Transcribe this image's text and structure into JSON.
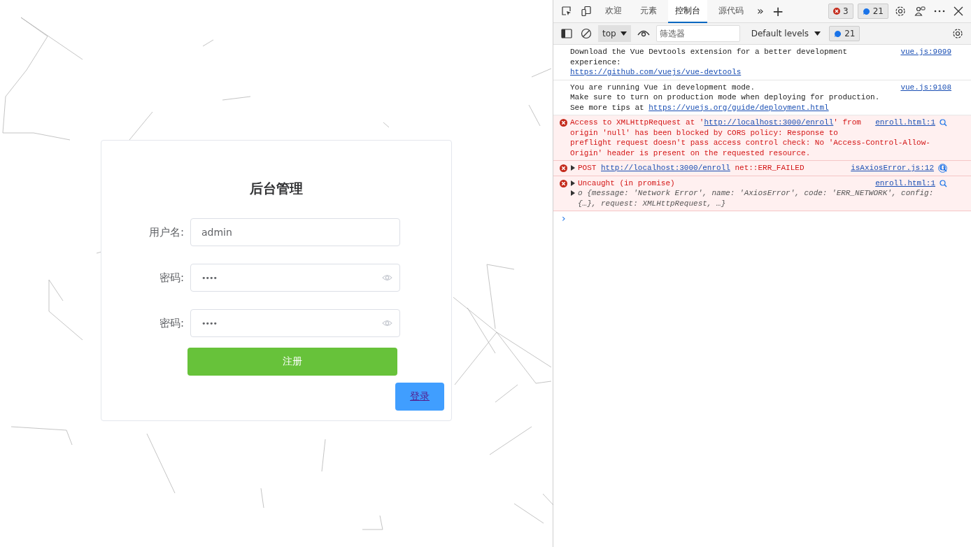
{
  "login_card": {
    "title": "后台管理",
    "fields": [
      {
        "label": "用户名:",
        "value": "admin",
        "kind": "text"
      },
      {
        "label": "密码:",
        "value": "••••",
        "kind": "password"
      },
      {
        "label": "密码:",
        "value": "••••",
        "kind": "password"
      }
    ],
    "register_button": "注册",
    "login_button": "登录"
  },
  "devtools": {
    "tabs": [
      {
        "label": "欢迎",
        "selected": false
      },
      {
        "label": "元素",
        "selected": false
      },
      {
        "label": "控制台",
        "selected": true
      },
      {
        "label": "源代码",
        "selected": false
      }
    ],
    "more_tabs": "»",
    "add_tab": "+",
    "error_count": "3",
    "message_count": "21",
    "console_toolbar": {
      "context": "top",
      "filter": {
        "placeholder": "筛选器"
      },
      "levels": "Default levels",
      "message_count": "21"
    },
    "messages": [
      {
        "kind": "info",
        "expandable": false,
        "source": "vue.js:9099",
        "lines": [
          [
            {
              "text": "Download the Vue Devtools extension for a better development",
              "link": false
            }
          ],
          [
            {
              "text": "experience:",
              "link": false
            }
          ],
          [
            {
              "text": "https://github.com/vuejs/vue-devtools",
              "link": true
            }
          ]
        ]
      },
      {
        "kind": "info",
        "expandable": false,
        "source": "vue.js:9108",
        "lines": [
          [
            {
              "text": "You are running Vue in development mode.",
              "link": false
            }
          ],
          [
            {
              "text": "Make sure to turn on production mode when deploying for production.",
              "link": false
            }
          ],
          [
            {
              "text": "See more tips at ",
              "link": false
            },
            {
              "text": "https://vuejs.org/guide/deployment.html",
              "link": true
            }
          ]
        ]
      },
      {
        "kind": "error",
        "expandable": false,
        "source": "enroll.html:1",
        "lines": [
          [
            {
              "text": "Access to XMLHttpRequest at '",
              "link": false
            },
            {
              "text": "http://localhost:3000/enroll",
              "link": true
            },
            {
              "text": "' from",
              "link": false
            }
          ],
          [
            {
              "text": "origin 'null' has been blocked by CORS policy: Response to",
              "link": false
            }
          ],
          [
            {
              "text": "preflight request doesn't pass access control check: No 'Access-Control-Allow-",
              "link": false
            }
          ],
          [
            {
              "text": "Origin' header is present on the requested resource.",
              "link": false
            }
          ]
        ]
      },
      {
        "kind": "error",
        "expandable": true,
        "network": true,
        "source": "isAxiosError.js:12",
        "lines": [
          [
            {
              "text": "POST ",
              "link": false
            },
            {
              "text": "http://localhost:3000/enroll",
              "link": true
            },
            {
              "text": " net::ERR_FAILED",
              "link": false
            }
          ]
        ]
      },
      {
        "kind": "error",
        "expandable": true,
        "source": "enroll.html:1",
        "lines": [
          [
            {
              "text": "Uncaught (in promise)",
              "link": false
            }
          ]
        ],
        "object": {
          "expandable": true,
          "lines": [
            "o {message: 'Network Error', name: 'AxiosError', code: 'ERR_NETWORK', config:",
            "{…}, request: XMLHttpRequest, …}"
          ]
        }
      }
    ],
    "prompt": "›"
  }
}
